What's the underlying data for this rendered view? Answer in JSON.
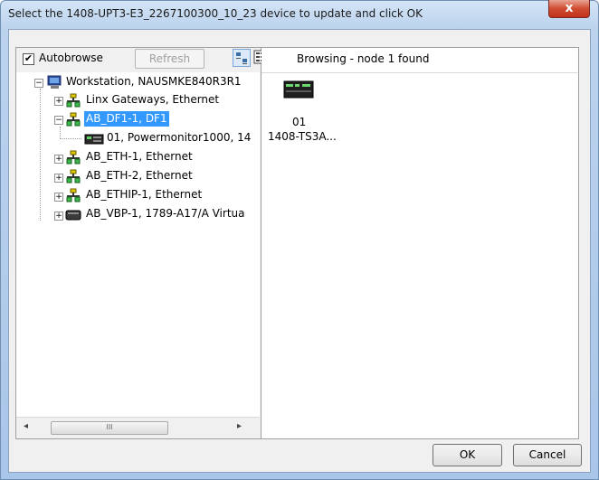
{
  "window": {
    "title": "Select the 1408-UPT3-E3_2267100300_10_23 device to update and click OK",
    "close_glyph": "x"
  },
  "toolbar": {
    "autobrowse_label": "Autobrowse",
    "autobrowse_checked": "✔",
    "refresh_label": "Refresh",
    "view_icons": [
      "small-icons-view-icon",
      "details-view-icon"
    ]
  },
  "status": {
    "text": "Browsing - node 1 found"
  },
  "tree": {
    "root": {
      "label": "Workstation, NAUSMKE840R3R1",
      "icon": "workstation-icon",
      "expander": "−"
    },
    "items": [
      {
        "label": "Linx Gateways, Ethernet",
        "icon": "network-icon",
        "expander": "+"
      },
      {
        "label": "AB_DF1-1, DF1",
        "icon": "network-icon",
        "expander": "−",
        "selected": true
      },
      {
        "label": "01, Powermonitor1000, 14",
        "icon": "device-icon"
      },
      {
        "label": "AB_ETH-1, Ethernet",
        "icon": "network-icon",
        "expander": "+"
      },
      {
        "label": "AB_ETH-2, Ethernet",
        "icon": "network-icon",
        "expander": "+"
      },
      {
        "label": "AB_ETHIP-1, Ethernet",
        "icon": "network-icon",
        "expander": "+"
      },
      {
        "label": "AB_VBP-1, 1789-A17/A Virtua",
        "icon": "backplane-icon",
        "expander": "+"
      }
    ]
  },
  "scrollbar": {
    "left_arrow": "◂",
    "right_arrow": "▸",
    "grip": "III"
  },
  "device": {
    "address": "01",
    "name": "1408-TS3A...",
    "icon": "powermonitor-device-icon"
  },
  "buttons": {
    "ok_label": "OK",
    "cancel_label": "Cancel"
  },
  "colors": {
    "selection": "#3399ff",
    "title_gradient": "#bcd3ee",
    "close": "#cf4d32"
  }
}
